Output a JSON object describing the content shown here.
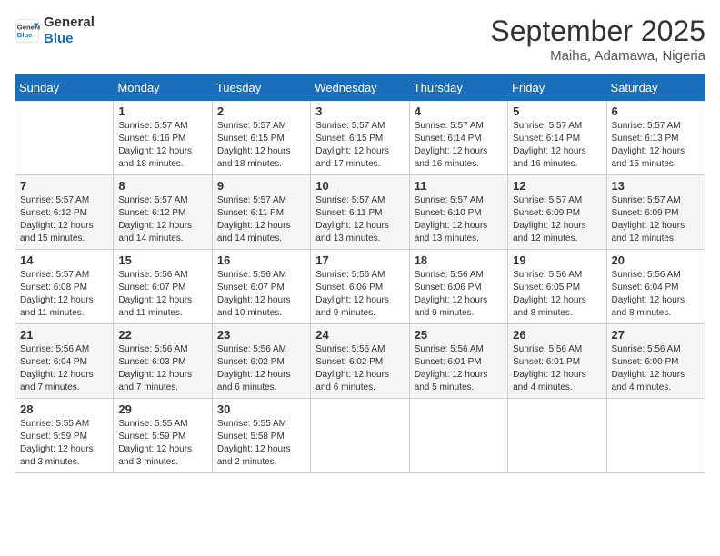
{
  "header": {
    "logo_line1": "General",
    "logo_line2": "Blue",
    "month": "September 2025",
    "location": "Maiha, Adamawa, Nigeria"
  },
  "days_of_week": [
    "Sunday",
    "Monday",
    "Tuesday",
    "Wednesday",
    "Thursday",
    "Friday",
    "Saturday"
  ],
  "weeks": [
    [
      {
        "day": "",
        "info": ""
      },
      {
        "day": "1",
        "info": "Sunrise: 5:57 AM\nSunset: 6:16 PM\nDaylight: 12 hours\nand 18 minutes."
      },
      {
        "day": "2",
        "info": "Sunrise: 5:57 AM\nSunset: 6:15 PM\nDaylight: 12 hours\nand 18 minutes."
      },
      {
        "day": "3",
        "info": "Sunrise: 5:57 AM\nSunset: 6:15 PM\nDaylight: 12 hours\nand 17 minutes."
      },
      {
        "day": "4",
        "info": "Sunrise: 5:57 AM\nSunset: 6:14 PM\nDaylight: 12 hours\nand 16 minutes."
      },
      {
        "day": "5",
        "info": "Sunrise: 5:57 AM\nSunset: 6:14 PM\nDaylight: 12 hours\nand 16 minutes."
      },
      {
        "day": "6",
        "info": "Sunrise: 5:57 AM\nSunset: 6:13 PM\nDaylight: 12 hours\nand 15 minutes."
      }
    ],
    [
      {
        "day": "7",
        "info": "Sunrise: 5:57 AM\nSunset: 6:12 PM\nDaylight: 12 hours\nand 15 minutes."
      },
      {
        "day": "8",
        "info": "Sunrise: 5:57 AM\nSunset: 6:12 PM\nDaylight: 12 hours\nand 14 minutes."
      },
      {
        "day": "9",
        "info": "Sunrise: 5:57 AM\nSunset: 6:11 PM\nDaylight: 12 hours\nand 14 minutes."
      },
      {
        "day": "10",
        "info": "Sunrise: 5:57 AM\nSunset: 6:11 PM\nDaylight: 12 hours\nand 13 minutes."
      },
      {
        "day": "11",
        "info": "Sunrise: 5:57 AM\nSunset: 6:10 PM\nDaylight: 12 hours\nand 13 minutes."
      },
      {
        "day": "12",
        "info": "Sunrise: 5:57 AM\nSunset: 6:09 PM\nDaylight: 12 hours\nand 12 minutes."
      },
      {
        "day": "13",
        "info": "Sunrise: 5:57 AM\nSunset: 6:09 PM\nDaylight: 12 hours\nand 12 minutes."
      }
    ],
    [
      {
        "day": "14",
        "info": "Sunrise: 5:57 AM\nSunset: 6:08 PM\nDaylight: 12 hours\nand 11 minutes."
      },
      {
        "day": "15",
        "info": "Sunrise: 5:56 AM\nSunset: 6:07 PM\nDaylight: 12 hours\nand 11 minutes."
      },
      {
        "day": "16",
        "info": "Sunrise: 5:56 AM\nSunset: 6:07 PM\nDaylight: 12 hours\nand 10 minutes."
      },
      {
        "day": "17",
        "info": "Sunrise: 5:56 AM\nSunset: 6:06 PM\nDaylight: 12 hours\nand 9 minutes."
      },
      {
        "day": "18",
        "info": "Sunrise: 5:56 AM\nSunset: 6:06 PM\nDaylight: 12 hours\nand 9 minutes."
      },
      {
        "day": "19",
        "info": "Sunrise: 5:56 AM\nSunset: 6:05 PM\nDaylight: 12 hours\nand 8 minutes."
      },
      {
        "day": "20",
        "info": "Sunrise: 5:56 AM\nSunset: 6:04 PM\nDaylight: 12 hours\nand 8 minutes."
      }
    ],
    [
      {
        "day": "21",
        "info": "Sunrise: 5:56 AM\nSunset: 6:04 PM\nDaylight: 12 hours\nand 7 minutes."
      },
      {
        "day": "22",
        "info": "Sunrise: 5:56 AM\nSunset: 6:03 PM\nDaylight: 12 hours\nand 7 minutes."
      },
      {
        "day": "23",
        "info": "Sunrise: 5:56 AM\nSunset: 6:02 PM\nDaylight: 12 hours\nand 6 minutes."
      },
      {
        "day": "24",
        "info": "Sunrise: 5:56 AM\nSunset: 6:02 PM\nDaylight: 12 hours\nand 6 minutes."
      },
      {
        "day": "25",
        "info": "Sunrise: 5:56 AM\nSunset: 6:01 PM\nDaylight: 12 hours\nand 5 minutes."
      },
      {
        "day": "26",
        "info": "Sunrise: 5:56 AM\nSunset: 6:01 PM\nDaylight: 12 hours\nand 4 minutes."
      },
      {
        "day": "27",
        "info": "Sunrise: 5:56 AM\nSunset: 6:00 PM\nDaylight: 12 hours\nand 4 minutes."
      }
    ],
    [
      {
        "day": "28",
        "info": "Sunrise: 5:55 AM\nSunset: 5:59 PM\nDaylight: 12 hours\nand 3 minutes."
      },
      {
        "day": "29",
        "info": "Sunrise: 5:55 AM\nSunset: 5:59 PM\nDaylight: 12 hours\nand 3 minutes."
      },
      {
        "day": "30",
        "info": "Sunrise: 5:55 AM\nSunset: 5:58 PM\nDaylight: 12 hours\nand 2 minutes."
      },
      {
        "day": "",
        "info": ""
      },
      {
        "day": "",
        "info": ""
      },
      {
        "day": "",
        "info": ""
      },
      {
        "day": "",
        "info": ""
      }
    ]
  ]
}
